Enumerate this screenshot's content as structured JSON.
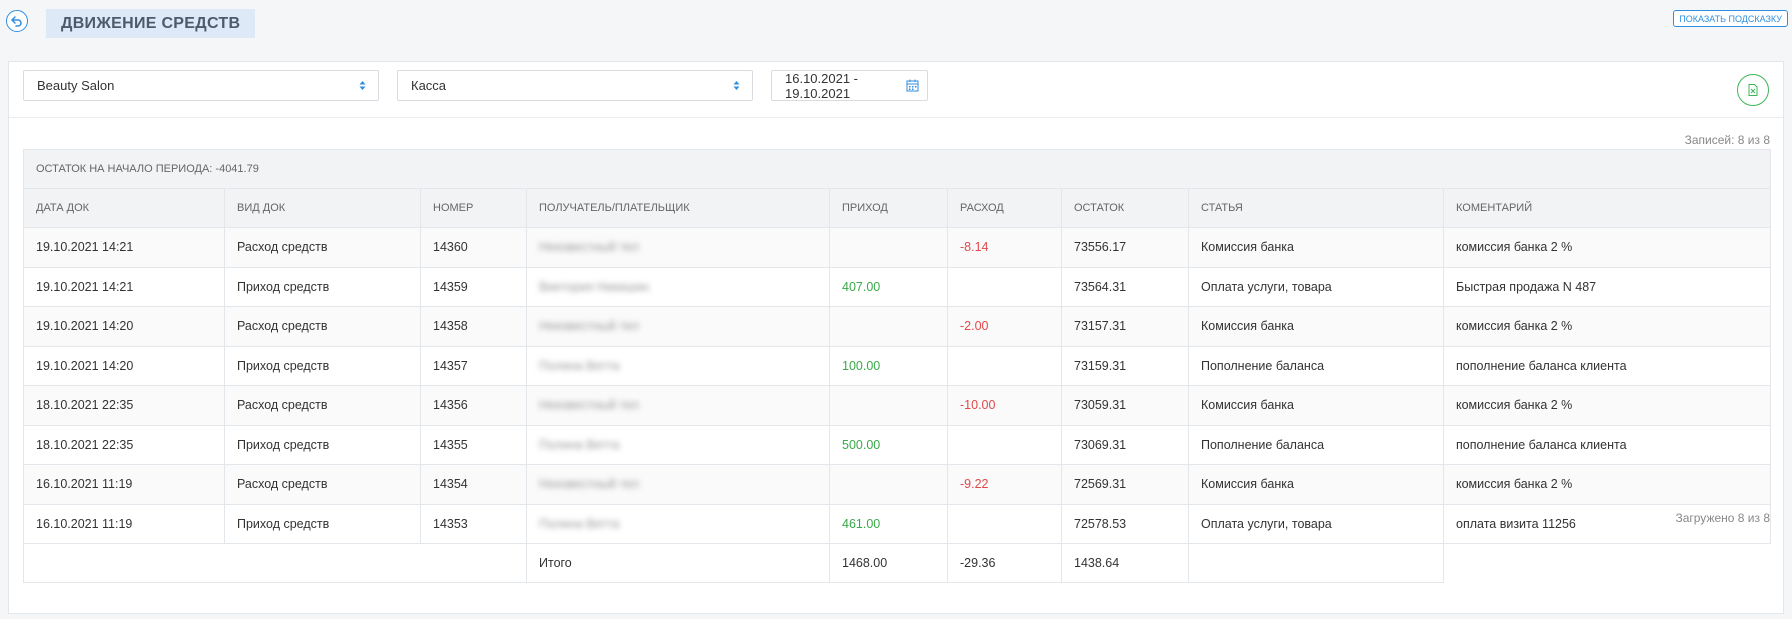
{
  "header": {
    "title": "ДВИЖЕНИЕ СРЕДСТВ",
    "hint_button": "ПОКАЗАТЬ ПОДСКАЗКУ"
  },
  "filters": {
    "salon": "Beauty Salon",
    "cashbox": "Касса",
    "date_range": "16.10.2021 - 19.10.2021"
  },
  "records_count": "Записей: 8 из 8",
  "opening_balance": "ОСТАТОК НА НАЧАЛО ПЕРИОДА: -4041.79",
  "columns": [
    "ДАТА ДОК",
    "ВИД ДОК",
    "НОМЕР",
    "ПОЛУЧАТЕЛЬ/ПЛАТЕЛЬЩИК",
    "ПРИХОД",
    "РАСХОД",
    "ОСТАТОК",
    "СТАТЬЯ",
    "КОМЕНТАРИЙ"
  ],
  "rows": [
    {
      "date": "19.10.2021 14:21",
      "type": "Расход средств",
      "number": "14360",
      "party": "Неизвестный тел",
      "income": "",
      "expense": "-8.14",
      "balance": "73556.17",
      "article": "Комиссия банка",
      "comment": "комиссия банка 2 %"
    },
    {
      "date": "19.10.2021 14:21",
      "type": "Приход средств",
      "number": "14359",
      "party": "Виктория Никишин",
      "income": "407.00",
      "expense": "",
      "balance": "73564.31",
      "article": "Оплата услуги, товара",
      "comment": "Быстрая продажа N 487"
    },
    {
      "date": "19.10.2021 14:20",
      "type": "Расход средств",
      "number": "14358",
      "party": "Неизвестный тел",
      "income": "",
      "expense": "-2.00",
      "balance": "73157.31",
      "article": "Комиссия банка",
      "comment": "комиссия банка 2 %"
    },
    {
      "date": "19.10.2021 14:20",
      "type": "Приход средств",
      "number": "14357",
      "party": "Полина Ветта",
      "income": "100.00",
      "expense": "",
      "balance": "73159.31",
      "article": "Пополнение баланса",
      "comment": "пополнение баланса клиента"
    },
    {
      "date": "18.10.2021 22:35",
      "type": "Расход средств",
      "number": "14356",
      "party": "Неизвестный тел",
      "income": "",
      "expense": "-10.00",
      "balance": "73059.31",
      "article": "Комиссия банка",
      "comment": "комиссия банка 2 %"
    },
    {
      "date": "18.10.2021 22:35",
      "type": "Приход средств",
      "number": "14355",
      "party": "Полина Ветта",
      "income": "500.00",
      "expense": "",
      "balance": "73069.31",
      "article": "Пополнение баланса",
      "comment": "пополнение баланса клиента"
    },
    {
      "date": "16.10.2021 11:19",
      "type": "Расход средств",
      "number": "14354",
      "party": "Неизвестный тел",
      "income": "",
      "expense": "-9.22",
      "balance": "72569.31",
      "article": "Комиссия банка",
      "comment": "комиссия банка 2 %"
    },
    {
      "date": "16.10.2021 11:19",
      "type": "Приход средств",
      "number": "14353",
      "party": "Полина Ветта",
      "income": "461.00",
      "expense": "",
      "balance": "72578.53",
      "article": "Оплата услуги, товара",
      "comment": "оплата визита 11256"
    }
  ],
  "totals": {
    "label": "Итого",
    "income": "1468.00",
    "expense": "-29.36",
    "balance": "1438.64"
  },
  "loaded_count": "Загружено 8 из 8",
  "colors": {
    "accent": "#2f8ee0",
    "income": "#3aa94a",
    "expense": "#e0494a",
    "export": "#3fb55a"
  }
}
